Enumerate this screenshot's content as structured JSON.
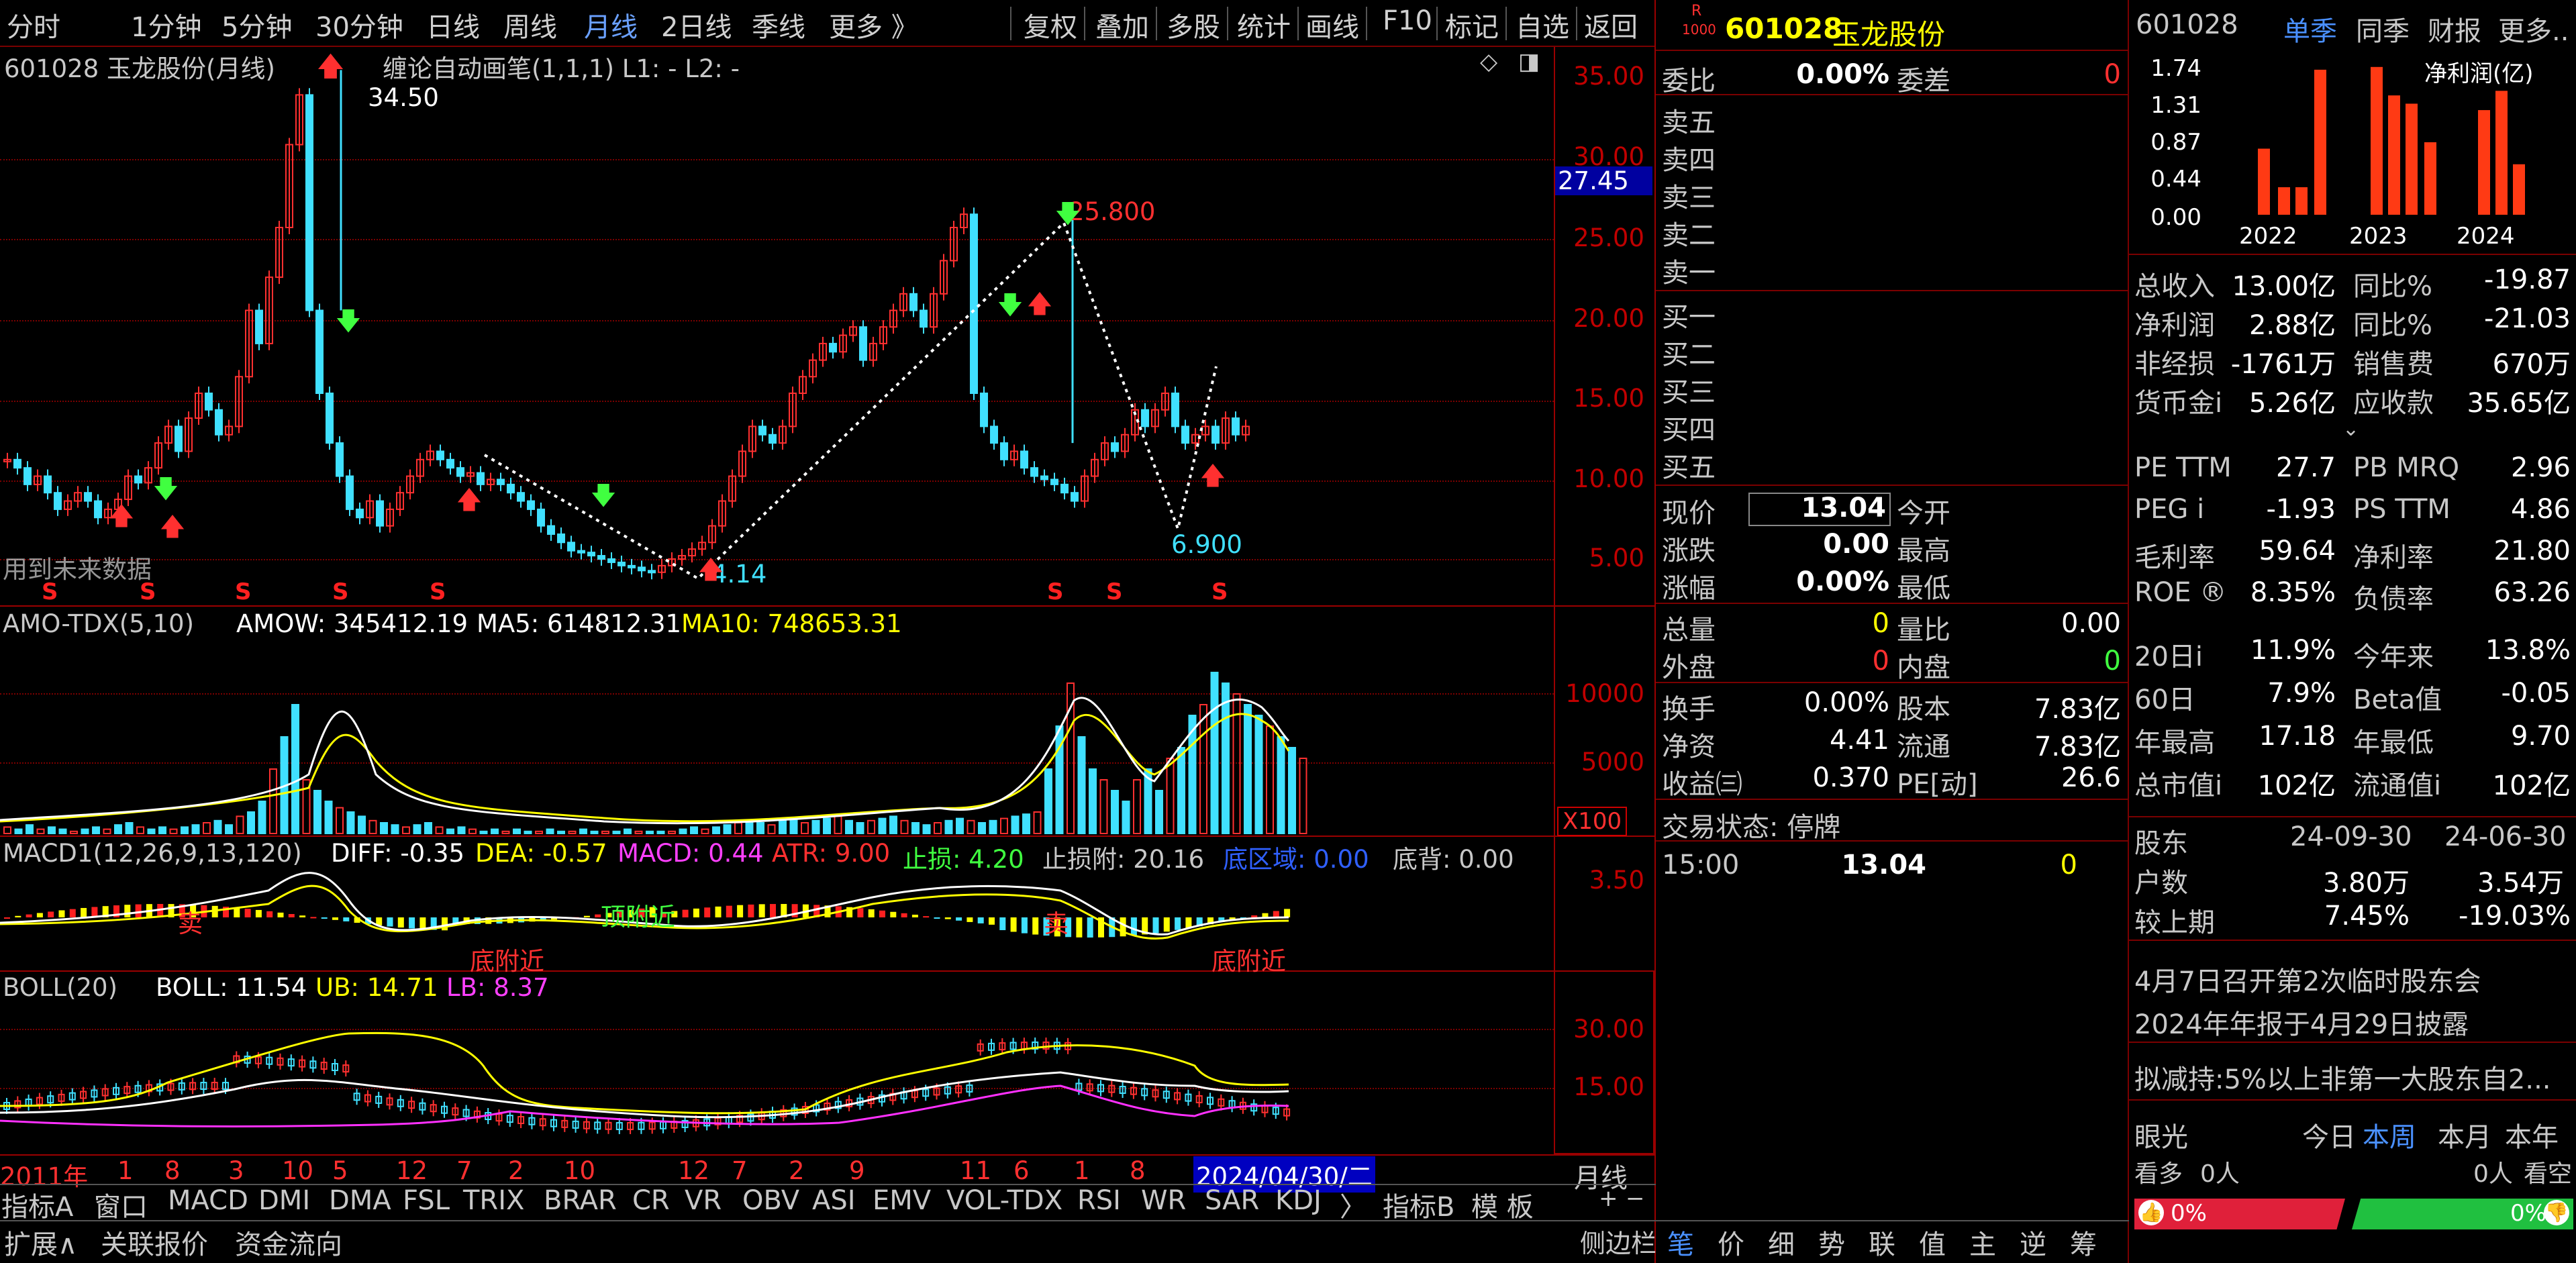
{
  "toolbar": {
    "periods": [
      "分时",
      "1分钟",
      "5分钟",
      "30分钟",
      "日线",
      "周线",
      "月线",
      "2日线",
      "季线",
      "更多 》"
    ],
    "active_period": "月线",
    "right_buttons": [
      "复权",
      "叠加",
      "多股",
      "统计",
      "画线",
      "F10",
      "标记",
      "自选",
      "返回"
    ]
  },
  "main_chart": {
    "title": "601028 玉龙股份(月线)",
    "indicator": "缠论自动画笔(1,1,1)  L1: -  L2: -",
    "y_ticks": [
      "35.00",
      "30.00",
      "25.00",
      "20.00",
      "15.00",
      "10.00",
      "5.00"
    ],
    "current_price_tag": "27.45",
    "annotations": {
      "high": "34.50",
      "peak": "25.800",
      "low_left": "4.14",
      "low_right": "6.900"
    },
    "note": "用到未来数据",
    "s_markers": [
      "S",
      "S",
      "S",
      "S",
      "S",
      "S",
      "S",
      "S"
    ]
  },
  "amo_panel": {
    "name": "AMO-TDX(5,10)",
    "amow": "AMOW: 345412.19",
    "ma5": "MA5: 614812.31",
    "ma10": "MA10: 748653.31",
    "y_ticks": [
      "10000",
      "5000"
    ],
    "unit": "X100"
  },
  "macd_panel": {
    "name": "MACD1(12,26,9,13,120)",
    "diff": "DIFF: -0.35",
    "dea": "DEA: -0.57",
    "macd": "MACD: 0.44",
    "atr": "ATR: 9.00",
    "stop": "止损: 4.20",
    "stop_near": "止损附: 20.16",
    "bottom_zone": "底区域: 0.00",
    "bottom_div": "底背: 0.00",
    "y_tick": "3.50",
    "labels": [
      "顶附近",
      "底附近",
      "底附近",
      "卖",
      "卖"
    ]
  },
  "boll_panel": {
    "name": "BOLL(20)",
    "boll": "BOLL: 11.54",
    "ub": "UB: 14.71",
    "lb": "LB: 8.37",
    "y_ticks": [
      "30.00",
      "15.00"
    ]
  },
  "x_axis": {
    "labels": [
      "2011年",
      "1",
      "8",
      "3",
      "10",
      "5",
      "12",
      "7",
      "2",
      "10",
      "12",
      "7",
      "2",
      "9",
      "11",
      "6",
      "1",
      "8"
    ],
    "cursor_date": "2024/04/30/二",
    "period": "月线"
  },
  "indicator_tabs": [
    "指标A",
    "窗口",
    "MACD",
    "DMI",
    "DMA",
    "FSL",
    "TRIX",
    "BRAR",
    "CR",
    "VR",
    "OBV",
    "ASI",
    "EMV",
    "VOL-TDX",
    "RSI",
    "WR",
    "SAR",
    "KDJ",
    "〉",
    "指标B",
    "模 板"
  ],
  "bottom_tabs": [
    "扩展∧",
    "关联报价",
    "资金流向"
  ],
  "side_bar_label": "侧边栏",
  "side_tabs": [
    "笔",
    "价",
    "细",
    "势",
    "联",
    "值",
    "主",
    "逆",
    "筹"
  ],
  "quote": {
    "code": "601028",
    "name": "玉龙股份",
    "r_badge": "R",
    "num_badge": "1000",
    "weibi_label": "委比",
    "weibi": "0.00%",
    "weicha_label": "委差",
    "weicha": "0",
    "sell": [
      "卖五",
      "卖四",
      "卖三",
      "卖二",
      "卖一"
    ],
    "buy": [
      "买一",
      "买二",
      "买三",
      "买四",
      "买五"
    ],
    "price_label": "现价",
    "price": "13.04",
    "open_label": "今开",
    "change_label": "涨跌",
    "change": "0.00",
    "high_label": "最高",
    "pct_label": "涨幅",
    "pct": "0.00%",
    "low_label": "最低",
    "vol_label": "总量",
    "vol": "0",
    "ratio_label": "量比",
    "ratio": "0.00",
    "outer_label": "外盘",
    "outer": "0",
    "inner_label": "内盘",
    "inner": "0",
    "turnover_label": "换手",
    "turnover": "0.00%",
    "shares_label": "股本",
    "shares": "7.83亿",
    "nav_label": "净资",
    "nav": "4.41",
    "float_label": "流通",
    "float": "7.83亿",
    "eps_label": "收益㈢",
    "eps": "0.370",
    "pe_label": "PE[动]",
    "pe": "26.6",
    "status": "交易状态: 停牌",
    "tick_time": "15:00",
    "tick_price": "13.04",
    "tick_vol": "0"
  },
  "finance": {
    "code": "601028",
    "tabs": [
      "单季",
      "同季",
      "财报",
      "更多.."
    ],
    "active_tab": "单季",
    "chart_title": "净利润(亿)",
    "y_ticks": [
      "1.74",
      "1.31",
      "0.87",
      "0.44",
      "0.00"
    ],
    "years": [
      "2022",
      "2023",
      "2024"
    ],
    "chart_data": {
      "type": "bar",
      "categories": [
        "2022",
        "2022",
        "2022",
        "2022",
        "2023",
        "2023",
        "2023",
        "2023",
        "2024",
        "2024",
        "2024"
      ],
      "values": [
        0.72,
        0.3,
        0.3,
        1.58,
        1.61,
        1.3,
        1.21,
        0.79,
        1.14,
        1.35,
        0.55
      ],
      "ylim": [
        0,
        1.74
      ]
    },
    "rows": [
      [
        "总收入",
        "13.00亿",
        "同比%",
        "-19.87"
      ],
      [
        "净利润",
        "2.88亿",
        "同比%",
        "-21.03"
      ],
      [
        "非经损",
        "-1761万",
        "销售费",
        "670万"
      ],
      [
        "货币金i",
        "5.26亿",
        "应收款",
        "35.65亿"
      ]
    ],
    "rows2": [
      [
        "PE TTM",
        "27.7",
        "PB MRQ",
        "2.96"
      ],
      [
        "PEG i",
        "-1.93",
        "PS TTM",
        "4.86"
      ],
      [
        "毛利率",
        "59.64",
        "净利率",
        "21.80"
      ],
      [
        "ROE ®",
        "8.35%",
        "负债率",
        "63.26"
      ]
    ],
    "rows3": [
      [
        "20日i",
        "11.9%",
        "今年来",
        "13.8%"
      ],
      [
        "60日",
        "7.9%",
        "Beta值",
        "-0.05"
      ],
      [
        "年最高",
        "17.18",
        "年最低",
        "9.70"
      ],
      [
        "总市值i",
        "102亿",
        "流通值i",
        "102亿"
      ]
    ],
    "holders": {
      "label": "股东",
      "date1": "24-09-30",
      "date2": "24-06-30",
      "count_label": "户数",
      "count1": "3.80万",
      "count2": "3.54万",
      "chg_label": "较上期",
      "chg1": "7.45%",
      "chg2": "-19.03%"
    },
    "news": [
      "4月7日召开第2次临时股东会",
      "2024年年报于4月29日披露",
      "拟减持:5%以上非第一大股东自2..."
    ],
    "sentiment": {
      "label": "眼光",
      "tabs": [
        "今日",
        "本周",
        "本月",
        "本年"
      ],
      "active": "本周",
      "bear_label": "看多",
      "bear_count": "0人",
      "bull_count": "0人",
      "bull_label": "看空",
      "left_pct": "0%",
      "right_pct": "0%"
    }
  }
}
